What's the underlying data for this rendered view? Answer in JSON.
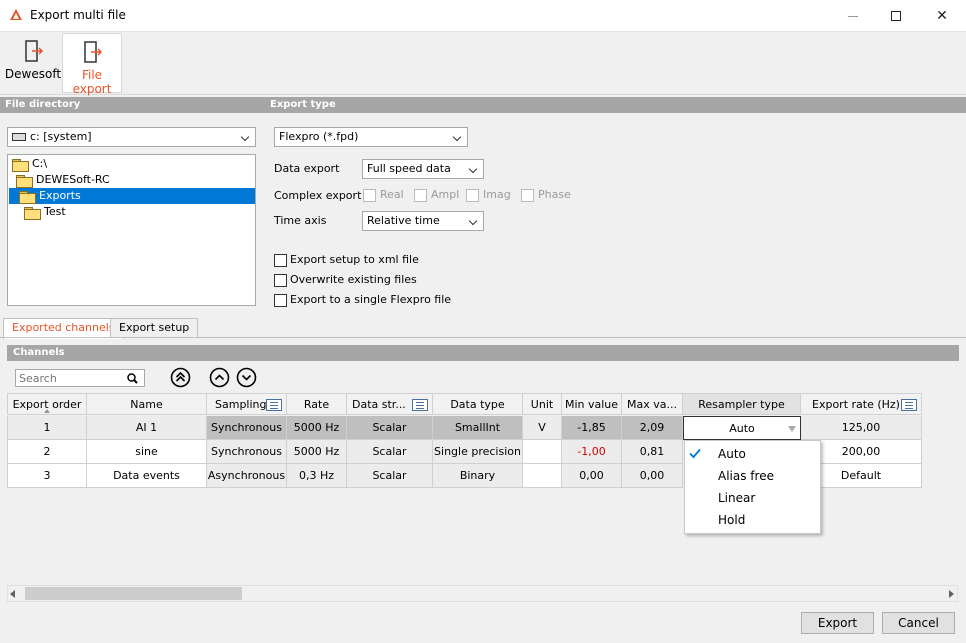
{
  "window": {
    "title": "Export multi file",
    "minimize_icon": "minimize-icon",
    "maximize_icon": "maximize-icon",
    "close_icon": "close-icon"
  },
  "toolbar": {
    "dewesoft_label": "Dewesoft",
    "file_export_label": "File export",
    "accent": "#e8542a"
  },
  "file_directory": {
    "header": "File directory",
    "drive": "c: [system]",
    "tree": [
      "C:\\",
      "DEWESoft-RC",
      "Exports",
      "Test"
    ],
    "selected": "Exports"
  },
  "export_type": {
    "header": "Export type",
    "format": "Flexpro (*.fpd)",
    "data_export_label": "Data export",
    "data_export_value": "Full speed data",
    "complex_export_label": "Complex export",
    "complex_options": [
      "Real",
      "Ampl",
      "Imag",
      "Phase"
    ],
    "time_axis_label": "Time axis",
    "time_axis_value": "Relative time",
    "options": [
      "Export setup to xml file",
      "Overwrite existing files",
      "Export to a single Flexpro file"
    ]
  },
  "tabs": {
    "exported_channels": "Exported channels",
    "export_setup": "Export setup"
  },
  "channels": {
    "header": "Channels",
    "search_placeholder": "Search",
    "columns": [
      "Export order",
      "Name",
      "Sampling",
      "Rate",
      "Data str...",
      "Data type",
      "Unit",
      "Min value",
      "Max va...",
      "Resampler type",
      "Export rate (Hz)"
    ],
    "rows": [
      {
        "order": "1",
        "name": "AI 1",
        "sampling": "Synchronous",
        "rate": "5000 Hz",
        "structure": "Scalar",
        "type": "SmallInt",
        "unit": "V",
        "min": "-1,85",
        "max": "2,09",
        "resampler": "Auto",
        "export_rate": "125,00"
      },
      {
        "order": "2",
        "name": "sine",
        "sampling": "Synchronous",
        "rate": "5000 Hz",
        "structure": "Scalar",
        "type": "Single precision",
        "unit": "",
        "min": "-1,00",
        "max": "0,81",
        "resampler": "",
        "export_rate": "200,00"
      },
      {
        "order": "3",
        "name": "Data events",
        "sampling": "Asynchronous",
        "rate": "0,3 Hz",
        "structure": "Scalar",
        "type": "Binary",
        "unit": "",
        "min": "0,00",
        "max": "0,00",
        "resampler": "",
        "export_rate": "Default"
      }
    ]
  },
  "resampler_menu": {
    "items": [
      "Auto",
      "Alias free",
      "Linear",
      "Hold"
    ],
    "checked": "Auto"
  },
  "buttons": {
    "export": "Export",
    "cancel": "Cancel"
  }
}
